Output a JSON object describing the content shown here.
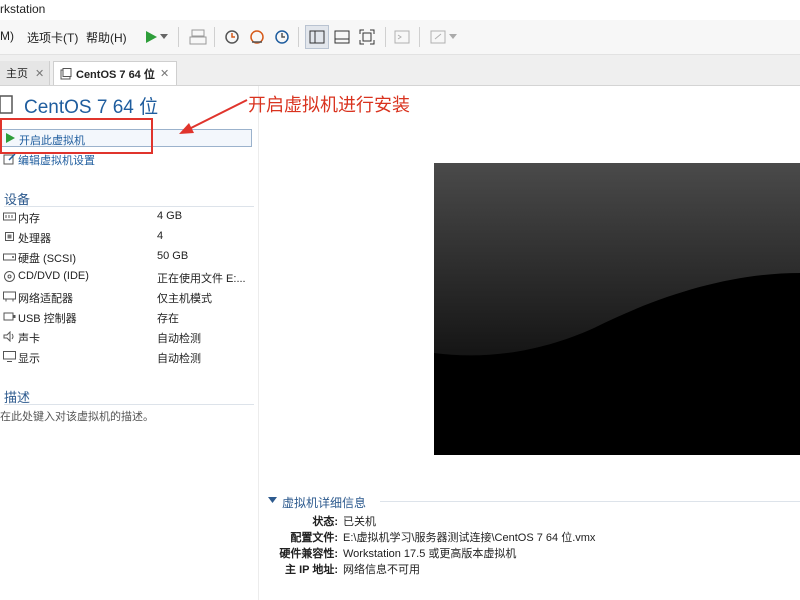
{
  "window": {
    "title": "rkstation"
  },
  "menu": {
    "items": [
      "M)",
      "选项卡(T)",
      "帮助(H)"
    ]
  },
  "tabs": {
    "home": "主页",
    "vm": "CentOS 7 64 位"
  },
  "vm": {
    "name": "CentOS 7 64 位",
    "actions": {
      "power_on": "开启此虚拟机",
      "edit": "编辑虚拟机设置"
    }
  },
  "devices": {
    "title": "设备",
    "items": [
      {
        "name": "内存",
        "value": "4 GB",
        "icon": "memory-icon"
      },
      {
        "name": "处理器",
        "value": "4",
        "icon": "cpu-icon"
      },
      {
        "name": "硬盘 (SCSI)",
        "value": "50 GB",
        "icon": "hard-disk-icon"
      },
      {
        "name": "CD/DVD (IDE)",
        "value": "正在使用文件 E:...",
        "icon": "cd-dvd-icon"
      },
      {
        "name": "网络适配器",
        "value": "仅主机模式",
        "icon": "network-adapter-icon"
      },
      {
        "name": "USB 控制器",
        "value": "存在",
        "icon": "usb-icon"
      },
      {
        "name": "声卡",
        "value": "自动检测",
        "icon": "sound-icon"
      },
      {
        "name": "显示",
        "value": "自动检测",
        "icon": "display-icon"
      }
    ]
  },
  "description": {
    "title": "描述",
    "placeholder": "在此处键入对该虚拟机的描述。"
  },
  "annotation": {
    "text": "开启虚拟机进行安装",
    "color": "#e0342c"
  },
  "details": {
    "title": "虚拟机详细信息",
    "rows": [
      {
        "label": "状态:",
        "value": "已关机"
      },
      {
        "label": "配置文件:",
        "value": "E:\\虚拟机学习\\服务器测试连接\\CentOS 7 64 位.vmx"
      },
      {
        "label": "硬件兼容性:",
        "value": "Workstation 17.5 或更高版本虚拟机"
      },
      {
        "label": "主 IP 地址:",
        "value": "网络信息不可用"
      }
    ]
  },
  "colors": {
    "accent": "#1f5d9e",
    "play": "#2e9e3a",
    "annotation": "#e0342c"
  }
}
